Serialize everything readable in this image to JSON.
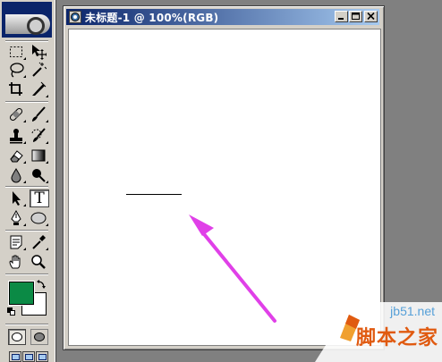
{
  "document": {
    "title": "未标题-1 @ 100%(RGB)"
  },
  "toolbox": {
    "tools": [
      {
        "name": "rectangular-marquee"
      },
      {
        "name": "move"
      },
      {
        "name": "lasso"
      },
      {
        "name": "magic-wand"
      },
      {
        "name": "crop"
      },
      {
        "name": "slice"
      },
      {
        "name": "healing-brush"
      },
      {
        "name": "brush"
      },
      {
        "name": "clone-stamp"
      },
      {
        "name": "history-brush"
      },
      {
        "name": "eraser"
      },
      {
        "name": "gradient"
      },
      {
        "name": "blur"
      },
      {
        "name": "dodge"
      },
      {
        "name": "path-selection"
      },
      {
        "name": "type",
        "label": "T",
        "active": true
      },
      {
        "name": "pen"
      },
      {
        "name": "ellipse-shape"
      },
      {
        "name": "notes"
      },
      {
        "name": "eyedropper"
      },
      {
        "name": "hand"
      },
      {
        "name": "zoom"
      }
    ],
    "foreground_color": "#0b8a45",
    "background_color": "#ffffff"
  },
  "watermark": {
    "url": "jb51.net",
    "name": "脚本之家"
  },
  "colors": {
    "title_bar_start": "#0a246a",
    "title_bar_end": "#a6caf0",
    "arrow": "#e040e8",
    "workspace": "#808080",
    "chrome": "#d4d0c8"
  }
}
